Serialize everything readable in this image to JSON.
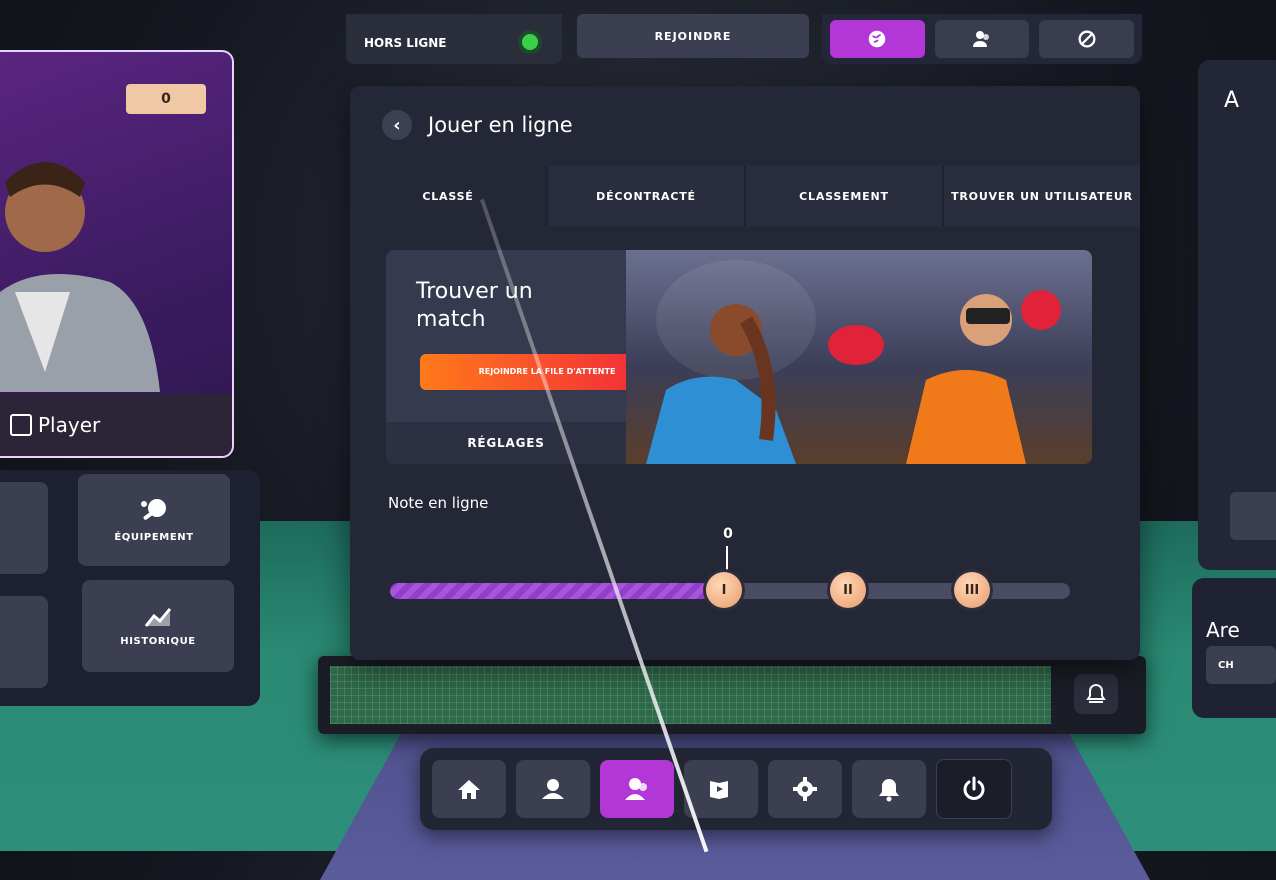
{
  "status_bar": {
    "status_label": "HORS LIGNE",
    "join_label": "REJOINDRE"
  },
  "top_icons": [
    {
      "icon": "globe-icon",
      "active": true
    },
    {
      "icon": "friends-icon",
      "active": false
    },
    {
      "icon": "blocked-icon",
      "active": false
    }
  ],
  "panel": {
    "title": "Jouer en ligne",
    "tabs": [
      "CLASSÉ",
      "DÉCONTRACTÉ",
      "CLASSEMENT",
      "TROUVER UN UTILISATEUR"
    ],
    "active_tab": "CLASSÉ",
    "match": {
      "title": "Trouver un match",
      "queue_button": "REJOINDRE LA FILE D'ATTENTE",
      "settings_button": "RÉGLAGES"
    },
    "rating": {
      "label": "Note en ligne",
      "value": "0",
      "progress_fraction": 0.47,
      "ranks": [
        "I",
        "II",
        "III"
      ]
    }
  },
  "player_card": {
    "badge": "0",
    "name": "Player"
  },
  "side_buttons": {
    "equipment_label": "ÉQUIPEMENT",
    "history_label": "HISTORIQUE"
  },
  "right_panel": {
    "title_fragment": "Are",
    "button_fragment": "CH",
    "corner_letter": "A"
  },
  "bottom_nav": [
    {
      "icon": "home-icon",
      "active": false
    },
    {
      "icon": "profile-icon",
      "active": false
    },
    {
      "icon": "online-players-icon",
      "active": true
    },
    {
      "icon": "video-icon",
      "active": false
    },
    {
      "icon": "settings-gear-icon",
      "active": false
    },
    {
      "icon": "bell-icon",
      "active": false
    },
    {
      "icon": "power-icon",
      "active": false
    }
  ],
  "colors": {
    "accent": "#b337d6",
    "online_green": "#3cd04a",
    "queue_orange": "#ff7a1a",
    "queue_red": "#f0223e"
  }
}
